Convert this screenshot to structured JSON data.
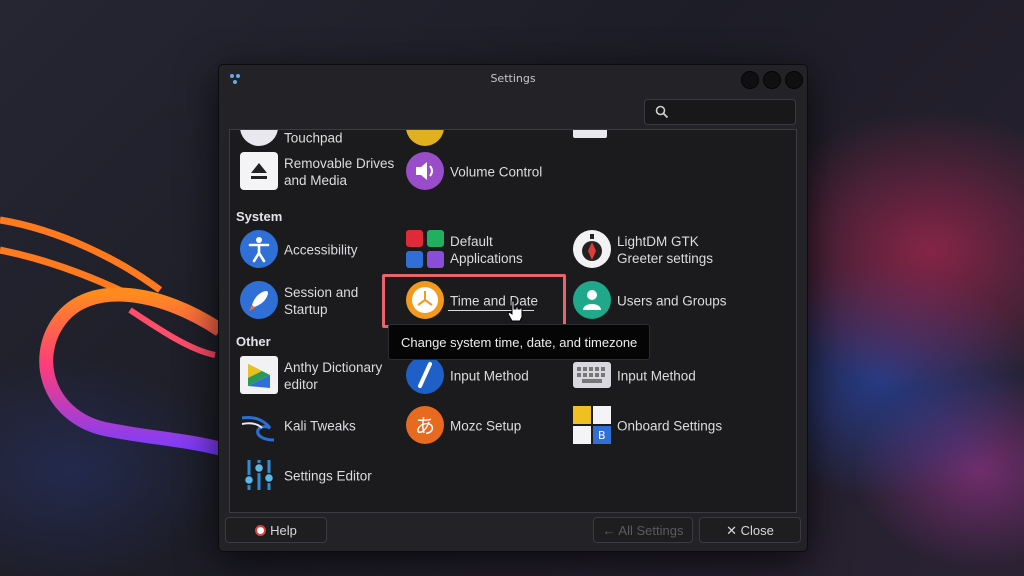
{
  "window": {
    "title": "Settings"
  },
  "search": {
    "placeholder": ""
  },
  "partial_top_row": [
    {
      "label": "Touchpad",
      "icon": "touchpad-icon"
    },
    {
      "label": "",
      "icon": "power-icon"
    },
    {
      "label": "",
      "icon": "display-icon"
    }
  ],
  "hardware": [
    {
      "label": "Removable Drives\nand Media",
      "icon": "eject-icon"
    },
    {
      "label": "Volume Control",
      "icon": "volume-icon"
    }
  ],
  "categories": {
    "system": "System",
    "other": "Other"
  },
  "system": [
    {
      "label": "Accessibility",
      "icon": "accessibility-icon"
    },
    {
      "label": "Default\nApplications",
      "icon": "default-apps-icon"
    },
    {
      "label": "LightDM GTK\nGreeter settings",
      "icon": "lightdm-icon"
    },
    {
      "label": "Session and Startup",
      "icon": "rocket-icon"
    },
    {
      "label": "Time and Date",
      "icon": "clock-icon"
    },
    {
      "label": "Users and Groups",
      "icon": "users-icon"
    }
  ],
  "other": [
    {
      "label": "Anthy Dictionary\neditor",
      "icon": "anthy-icon"
    },
    {
      "label": "Input Method",
      "icon": "input-method-icon"
    },
    {
      "label": "Input Method",
      "icon": "keyboard-icon"
    },
    {
      "label": "Kali Tweaks",
      "icon": "kali-dragon-icon"
    },
    {
      "label": "Mozc Setup",
      "icon": "mozc-icon"
    },
    {
      "label": "Onboard Settings",
      "icon": "onboard-icon"
    },
    {
      "label": "Settings Editor",
      "icon": "settings-editor-icon"
    }
  ],
  "tooltip": {
    "text": "Change system time, date, and timezone"
  },
  "footer": {
    "help": "Help",
    "all_settings": "All Settings",
    "close": "Close"
  },
  "colors": {
    "highlight": "#e8646c",
    "window_bg": "#232327",
    "accent_blue": "#2f6fd6"
  }
}
